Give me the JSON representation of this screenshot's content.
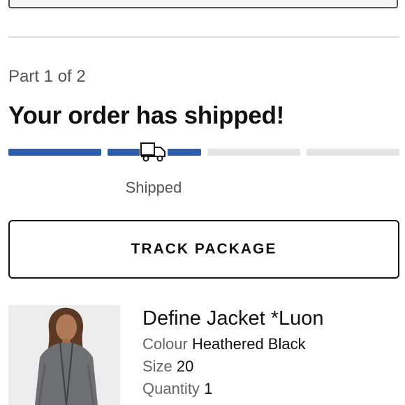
{
  "order": {
    "part_label": "Part 1 of 2",
    "heading": "Your order has shipped!",
    "progress": {
      "steps_total": 4,
      "current_step": 2,
      "active_color": "#2d5fa8",
      "inactive_color": "#e4e4e4",
      "status_icon": "truck-icon",
      "status_label": "Shipped"
    },
    "track_button_label": "TRACK PACKAGE"
  },
  "product": {
    "name": "Define Jacket *Luon",
    "colour_label": "Colour",
    "colour_value": "Heathered Black",
    "size_label": "Size",
    "size_value": "20",
    "quantity_label": "Quantity",
    "quantity_value": "1"
  }
}
